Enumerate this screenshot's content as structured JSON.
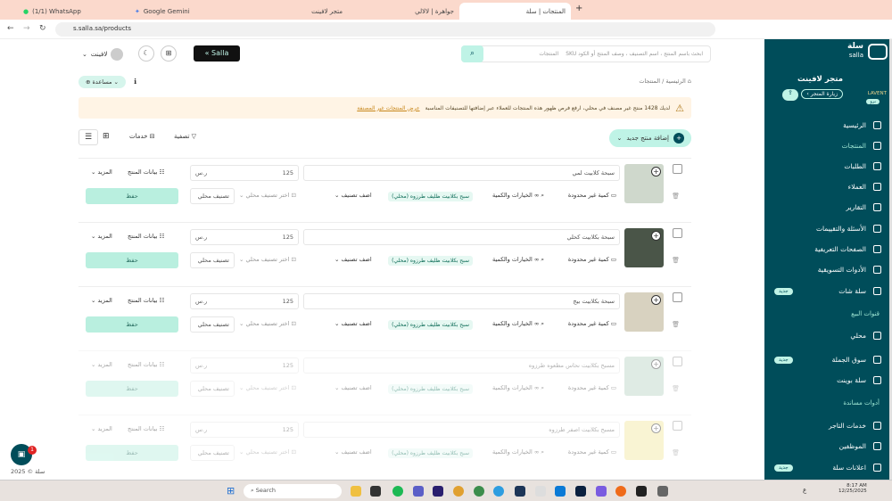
{
  "browser": {
    "tabs": [
      {
        "label": "(1/1) WhatsApp"
      },
      {
        "label": "Google Gemini"
      },
      {
        "label": "متجر لافينت"
      },
      {
        "label": "جواهرة | لالالي"
      },
      {
        "label": "المنتجات | سلة"
      }
    ],
    "url": "s.salla.sa/products"
  },
  "header": {
    "search_placeholder": "ابحث باسم المنتج ، اسم التصنيف ، وصف المنتج أو الكود SKU",
    "search_scope": "المنتجات",
    "logo": "Salla",
    "user": "لافينت"
  },
  "sidebar": {
    "brand": "سلة",
    "brand_en": "salla",
    "store_name": "متجر لافينت",
    "store_logo": "LAVENT",
    "plan": "برو",
    "visit_store": "زيارة المتجر",
    "items": [
      {
        "label": "الرئيسية"
      },
      {
        "label": "المنتجات"
      },
      {
        "label": "الطلبات"
      },
      {
        "label": "العملاء"
      },
      {
        "label": "التقارير"
      },
      {
        "label": "الأسئلة والتقييمات"
      },
      {
        "label": "الصفحات التعريفية"
      },
      {
        "label": "الأدوات التسويقية"
      },
      {
        "label": "سلة شات",
        "badge": "جديد"
      }
    ],
    "sales_title": "قنوات البيع",
    "sales": [
      {
        "label": "محلي"
      },
      {
        "label": "سوق الجملة",
        "badge": "جديد"
      },
      {
        "label": "سلة بوينت"
      }
    ],
    "tools_title": "أدوات مساندة",
    "tools": [
      {
        "label": "خدمات التاجر"
      },
      {
        "label": "الموظفين"
      },
      {
        "label": "اعلانات سلة",
        "badge": "جديد"
      }
    ]
  },
  "main": {
    "breadcrumb_home": "الرئيسية",
    "breadcrumb_current": "المنتجات",
    "help": "مساعدة",
    "alert": "لديك 1428 منتج غير مصنف في محلي، ارفع فرص ظهور هذه المنتجات للعملاء عبر إضافتها للتصنيفات المناسبة",
    "alert_link": "عرض المنتجات غير المصنفة",
    "add_product": "إضافة منتج جديد",
    "filter": "تصفية",
    "services": "خدمات",
    "labels": {
      "currency": "ر.س",
      "product_data": "بيانات المنتج",
      "more": "المزيد",
      "qty": "كمية غير محدودة",
      "options": "الخيارات والكمية",
      "add_category": "اضف تصنيف",
      "choose_local": "اختر تصنيف محلي",
      "local": "تصنيف محلي",
      "save": "حفظ"
    },
    "products": [
      {
        "name": "سبحة كلابيت لمي",
        "price": "125",
        "category": "سبح بكلابيت ظليف طرزوه (محلي)",
        "faded": false
      },
      {
        "name": "سبحة بكلابيت كحلي",
        "price": "125",
        "category": "سبح بكلابيت ظليف طرزوه (محلي)",
        "faded": false
      },
      {
        "name": "سبحة بكلابيت بيج",
        "price": "125",
        "category": "سبح بكلابيت ظليف طرزوه (محلي)",
        "faded": false
      },
      {
        "name": "مسبح بكلابيت نحاس مطعوه طرزوه",
        "price": "125",
        "category": "سبح بكلابيت ظليف طرزوه (محلي)",
        "faded": true
      },
      {
        "name": "مسبح بكلابيت اصفر طرزوه",
        "price": "125",
        "category": "سبح بكلابيت ظليف طرزوه (محلي)",
        "faded": true
      }
    ],
    "footer": "سلة © 2025",
    "chat_count": "1"
  },
  "taskbar": {
    "search": "Search",
    "time": "8:17 AM",
    "date": "12/25/2025",
    "lang": "ع"
  },
  "colors": {
    "primary": "#004d5a",
    "accent": "#bff3e6",
    "alert_bg": "#fff4e5"
  }
}
